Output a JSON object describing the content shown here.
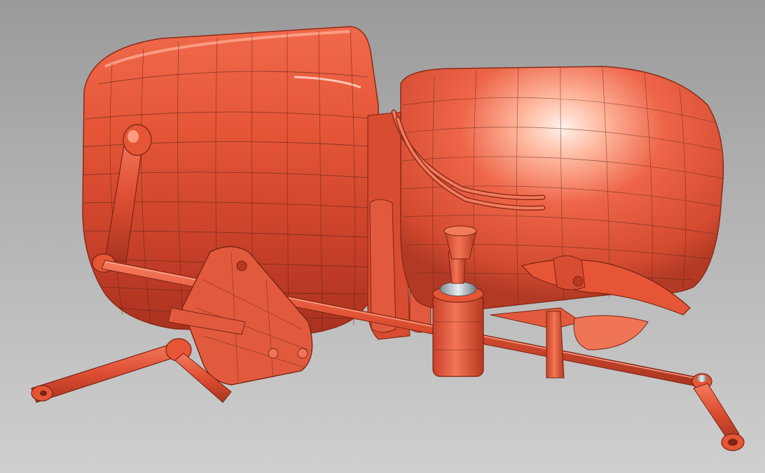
{
  "scene": {
    "description_visible_text": "",
    "colors": {
      "background_top": "#9a9a9a",
      "background_bottom": "#cfcfcf",
      "model_base": "#e8553a",
      "model_dark": "#b8361f",
      "model_highlight": "#ffd7c8",
      "wireframe": "#5a2418",
      "chrome": "#b8c2c8"
    }
  }
}
